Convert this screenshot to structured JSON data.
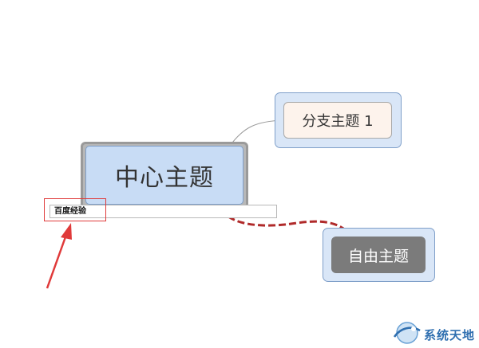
{
  "mindmap": {
    "central_topic": {
      "label": "中心主题"
    },
    "branch_topic": {
      "label": "分支主题 1"
    },
    "floating_topic": {
      "label": "自由主题"
    },
    "label_editor": {
      "value": "百度经验"
    }
  },
  "watermark": {
    "text": "系统天地"
  },
  "colors": {
    "central_fill": "#c8dcf5",
    "selection_fill": "#d9e6f7",
    "branch_fill": "#fdf3ec",
    "floating_fill": "#7b7b7b",
    "relationship_line": "#b02a2a",
    "annotation_arrow": "#e03a3a"
  }
}
